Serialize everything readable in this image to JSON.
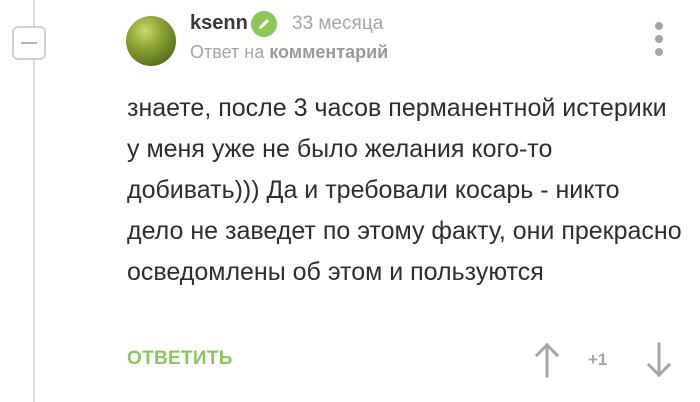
{
  "comment": {
    "username": "ksenn",
    "time": "33 месяца",
    "reply_prefix": "Ответ на",
    "reply_link": "комментарий",
    "text": "знаете, после 3 часов перманентной истерики у меня уже не было желания кого-то добивать))) Да и требовали косарь - никто дело не заведет по этому факту, они прекрасно осведомлены об этом и пользуются",
    "reply_button": "ОТВЕТИТЬ",
    "rating": "+1"
  },
  "colors": {
    "accent_green": "#8ac858",
    "muted_gray": "#a5a5a5",
    "text": "#2e2e2e"
  },
  "icons": {
    "collapse": "minus-icon",
    "badge": "pencil-icon",
    "menu": "more-vertical-icon",
    "vote_up": "arrow-up-icon",
    "vote_down": "arrow-down-icon"
  }
}
